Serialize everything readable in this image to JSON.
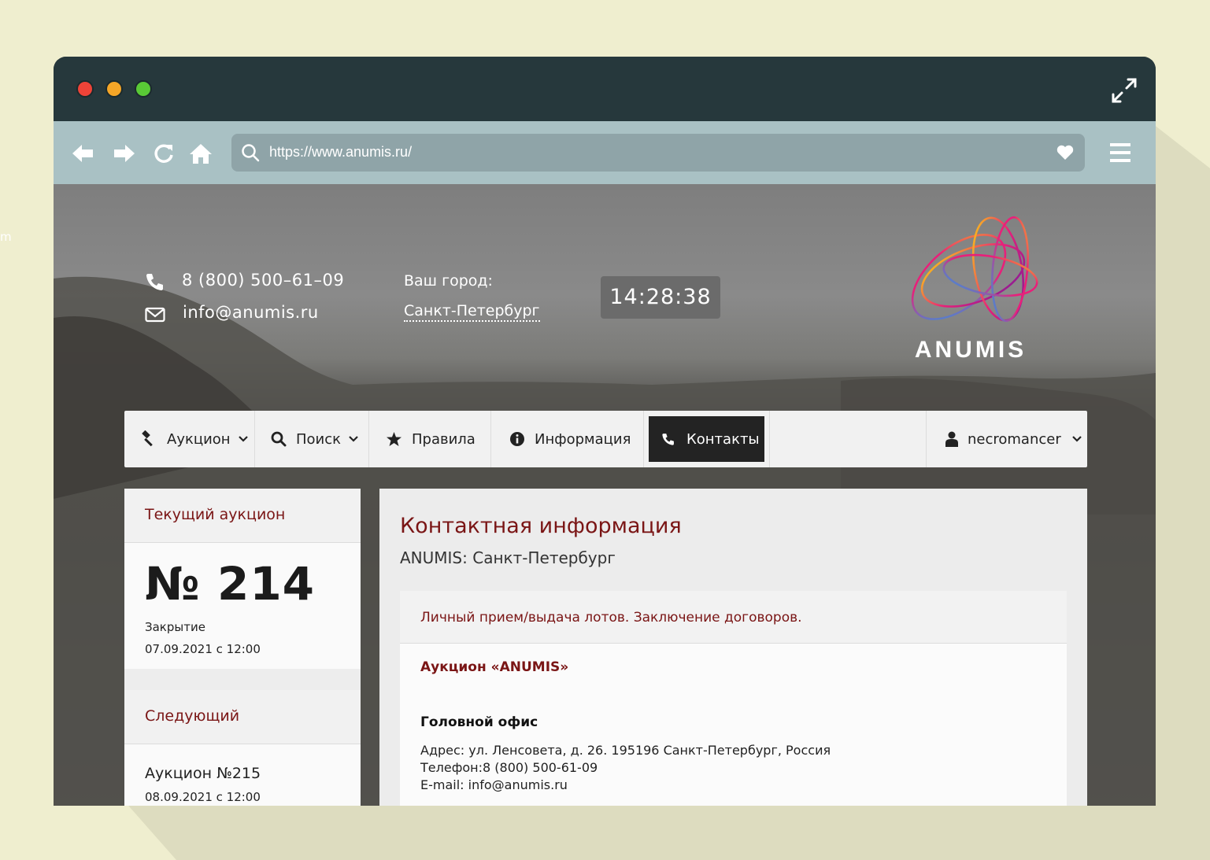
{
  "edge_fragment": "m",
  "browser": {
    "url": "https://www.anumis.ru/"
  },
  "header": {
    "phone": "8 (800) 500–61–09",
    "email": "info@anumis.ru",
    "city_label": "Ваш город:",
    "city": "Санкт-Петербург",
    "clock": "14:28:38",
    "logo_text": "ANUMIS"
  },
  "nav": {
    "items": [
      {
        "label": "Аукцион",
        "icon": "gavel-icon"
      },
      {
        "label": "Поиск",
        "icon": "search-icon"
      },
      {
        "label": "Правила",
        "icon": "star-icon"
      },
      {
        "label": "Информация",
        "icon": "info-icon"
      },
      {
        "label": "Контакты",
        "icon": "phone-icon"
      }
    ],
    "user": "necromancer"
  },
  "sidebar": {
    "current_heading": "Текущий аукцион",
    "current_number": "№ 214",
    "closing_label": "Закрытие",
    "closing_date": "07.09.2021 с 12:00",
    "next_heading": "Следующий",
    "next_title": "Аукцион №215",
    "next_date": "08.09.2021 с 12:00"
  },
  "main": {
    "title": "Контактная информация",
    "subtitle": "ANUMIS: Санкт-Петербург",
    "card_heading": "Личный прием/выдача лотов. Заключение договоров.",
    "org": "Аукцион «ANUMIS»",
    "office": "Головной офис",
    "address": "Адрес: ул. Ленсовета, д. 26. 195196 Санкт-Петербург, Россия",
    "phone": "Телефон:8 (800) 500-61-09",
    "email": "E-mail: info@anumis.ru"
  },
  "colors": {
    "accent": "#7a1515",
    "titlebar": "#26383c",
    "toolbar": "#a9c1c4"
  }
}
